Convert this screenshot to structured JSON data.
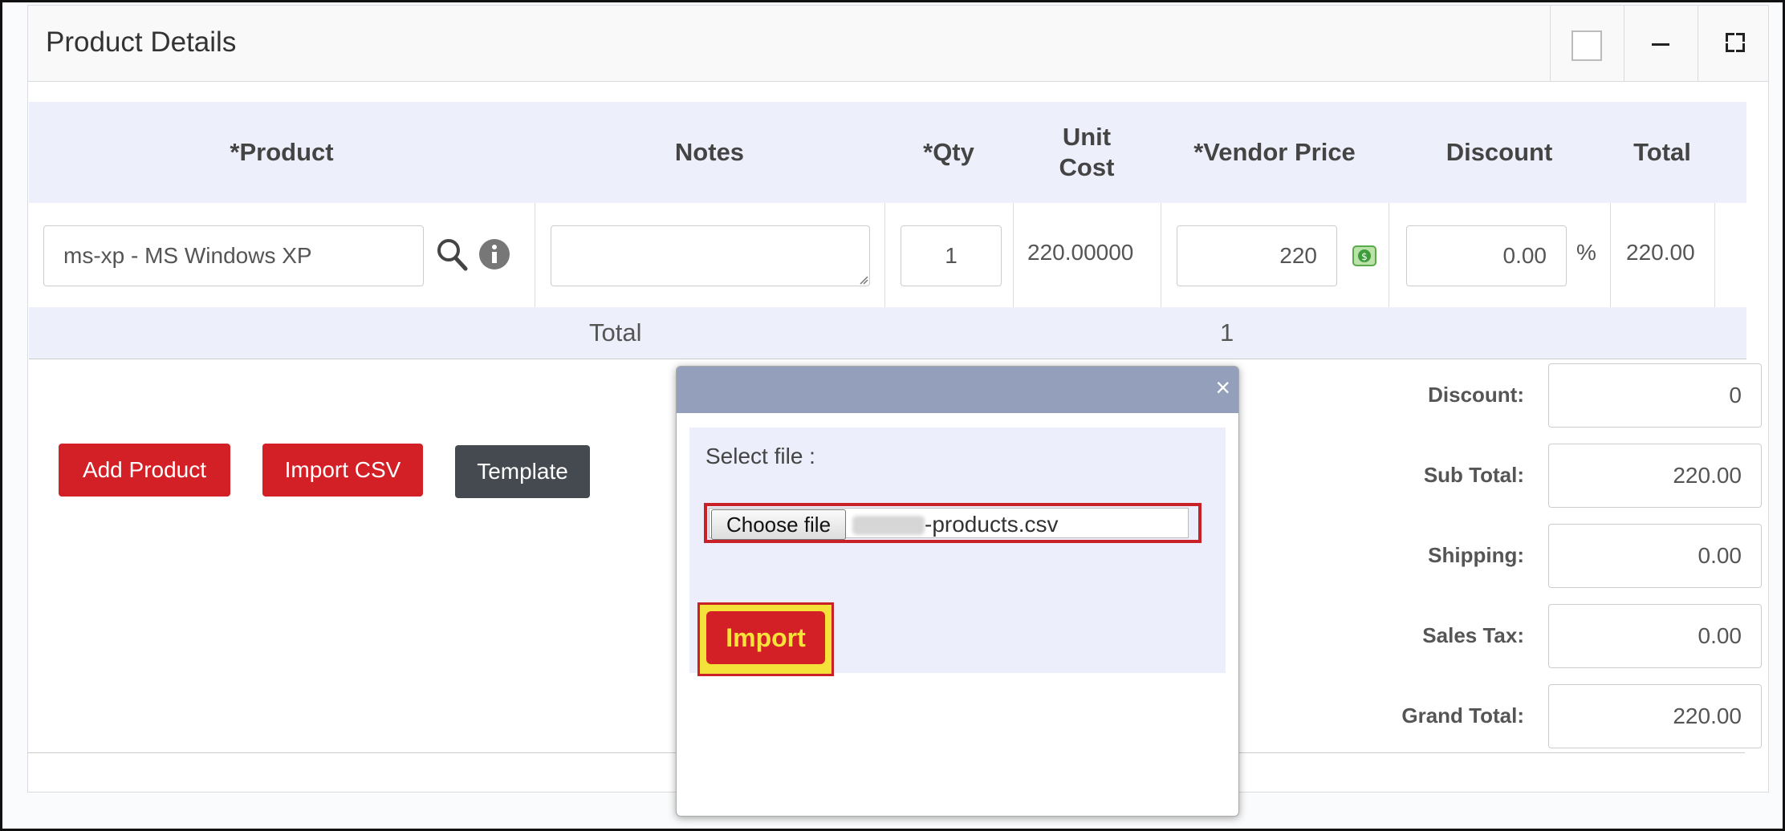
{
  "panel": {
    "title": "Product Details"
  },
  "table": {
    "headers": [
      "*Product",
      "Notes",
      "*Qty",
      "Unit Cost",
      "*Vendor Price",
      "Discount",
      "Total"
    ],
    "row": {
      "product": "ms-xp - MS Windows XP",
      "notes": "",
      "qty": "1",
      "unit_cost": "220.00000",
      "vendor_price": "220",
      "discount": "0.00",
      "discount_unit": "%",
      "total": "220.00"
    },
    "total_row": {
      "label": "Total",
      "qty_total": "1"
    }
  },
  "actions": {
    "add_product": "Add Product",
    "import_csv": "Import CSV",
    "template": "Template"
  },
  "summary": [
    {
      "label": "Discount:",
      "value": "0"
    },
    {
      "label": "Sub Total:",
      "value": "220.00"
    },
    {
      "label": "Shipping:",
      "value": "0.00"
    },
    {
      "label": "Sales Tax:",
      "value": "0.00"
    },
    {
      "label": "Grand Total:",
      "value": "220.00"
    }
  ],
  "dialog": {
    "close": "×",
    "select_label": "Select file :",
    "choose_file": "Choose file",
    "file_name": "-products.csv",
    "import": "Import"
  },
  "colors": {
    "header_bg": "#edf0fb",
    "danger": "#d32027",
    "dark_button": "#454a51",
    "dialog_title": "#949fbb",
    "highlight_yellow": "#f4e23a"
  }
}
